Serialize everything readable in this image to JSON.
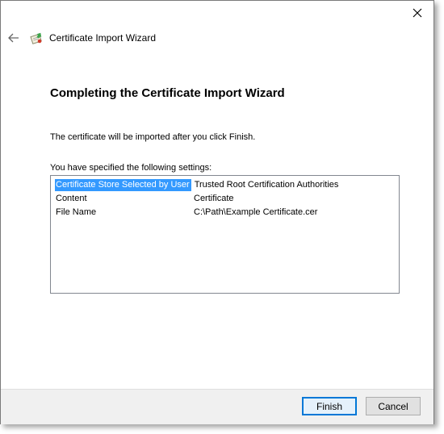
{
  "window": {
    "title": "Certificate Import Wizard",
    "icons": {
      "close": "close-icon",
      "back": "back-arrow-icon",
      "app": "certificate-wizard-icon"
    }
  },
  "main": {
    "heading": "Completing the Certificate Import Wizard",
    "intro": "The certificate will be imported after you click Finish.",
    "settings_label": "You have specified the following settings:",
    "settings": [
      {
        "key": "Certificate Store Selected by User",
        "value": "Trusted Root Certification Authorities",
        "selected": true
      },
      {
        "key": "Content",
        "value": "Certificate",
        "selected": false
      },
      {
        "key": "File Name",
        "value": "C:\\Path\\Example Certificate.cer",
        "selected": false
      }
    ]
  },
  "footer": {
    "finish_label": "Finish",
    "cancel_label": "Cancel"
  },
  "colors": {
    "selection": "#3399ff",
    "default_button_border": "#0078d7",
    "footer_bg": "#f0f0f0"
  }
}
